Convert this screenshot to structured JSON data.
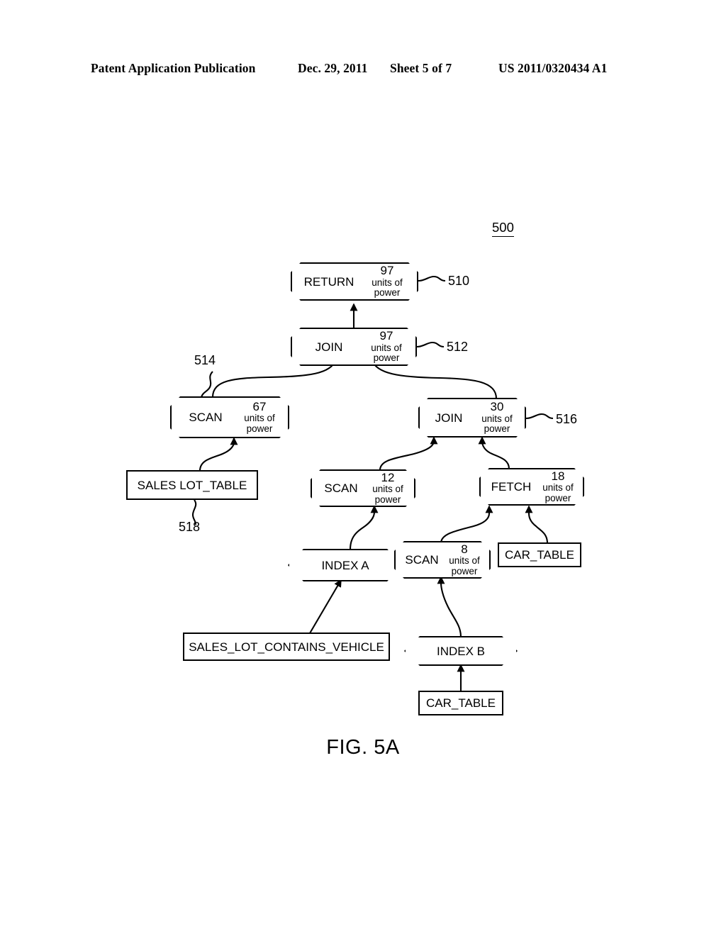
{
  "header": {
    "publication": "Patent Application Publication",
    "date": "Dec. 29, 2011",
    "sheet": "Sheet 5 of 7",
    "patent_number": "US 2011/0320434 A1"
  },
  "figure": {
    "caption": "FIG. 5A",
    "diagram_ref": "500",
    "cost_unit_label": "units of\npower",
    "cost_unit_line1": "units of",
    "cost_unit_line2": "power"
  },
  "nodes": {
    "return_510": {
      "name": "RETURN",
      "cost": "97",
      "unit1": "units of",
      "unit2": "power",
      "ref": "510"
    },
    "join_512": {
      "name": "JOIN",
      "cost": "97",
      "unit1": "units of",
      "unit2": "power",
      "ref": "512"
    },
    "scan_514": {
      "name": "SCAN",
      "cost": "67",
      "unit1": "units of",
      "unit2": "power",
      "ref": "514"
    },
    "join_516": {
      "name": "JOIN",
      "cost": "30",
      "unit1": "units of",
      "unit2": "power",
      "ref": "516"
    },
    "sales_lot_table_518": {
      "label": "SALES LOT_TABLE",
      "ref": "518"
    },
    "scan_12": {
      "name": "SCAN",
      "cost": "12",
      "unit1": "units of",
      "unit2": "power"
    },
    "fetch_18": {
      "name": "FETCH",
      "cost": "18",
      "unit1": "units of",
      "unit2": "power"
    },
    "scan_8": {
      "name": "SCAN",
      "cost": "8",
      "unit1": "units of",
      "unit2": "power"
    },
    "index_a": {
      "label": "INDEX  A"
    },
    "index_b": {
      "label": "INDEX  B"
    },
    "car_table_upper": {
      "label": "CAR_TABLE"
    },
    "car_table_lower": {
      "label": "CAR_TABLE"
    },
    "sales_lot_contains_vehicle": {
      "label": "SALES_LOT_CONTAINS_VEHICLE"
    }
  },
  "colors": {
    "ink": "#000000",
    "page": "#ffffff"
  }
}
